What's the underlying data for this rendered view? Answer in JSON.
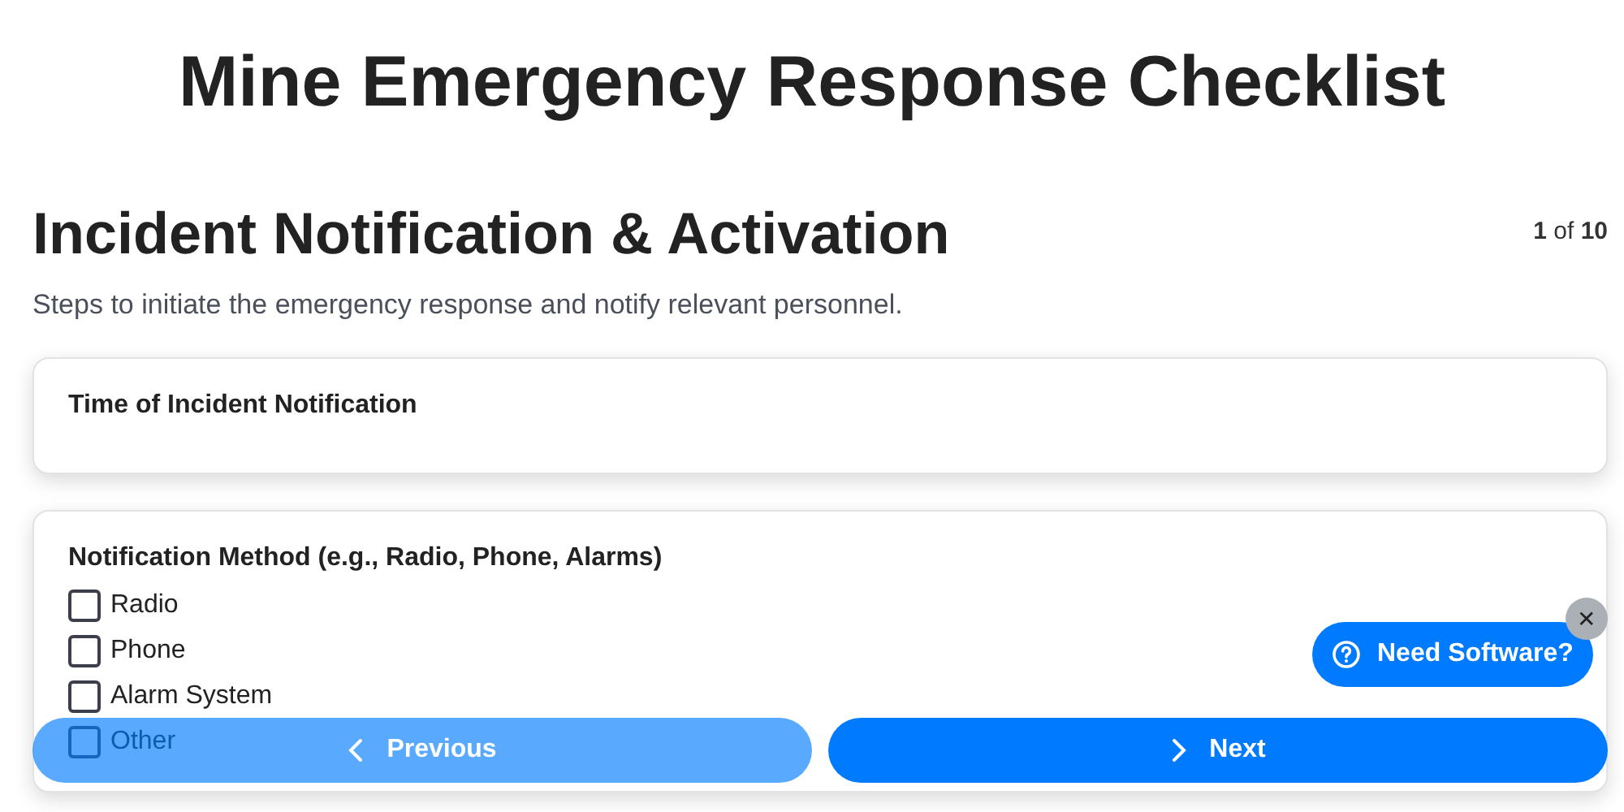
{
  "title": "Mine Emergency Response Checklist",
  "section": {
    "heading": "Incident Notification & Activation",
    "counter": "**1** of **10**",
    "description": "Steps to initiate the emergency response and notify relevant personnel."
  },
  "cards": [
    {
      "kind": "text",
      "label": "Time of Incident Notification"
    },
    {
      "kind": "checklist",
      "label": "Notification Method (e.g., Radio, Phone, Alarms)",
      "options": [
        {
          "label": "Radio",
          "checked": false
        },
        {
          "label": "Phone",
          "checked": false
        },
        {
          "label": "Alarm System",
          "checked": false
        },
        {
          "label": "Other",
          "checked": false
        }
      ]
    }
  ],
  "nav": {
    "previous": "Previous",
    "next": "Next"
  },
  "help": {
    "label": "Need Software?",
    "close": "✕"
  }
}
